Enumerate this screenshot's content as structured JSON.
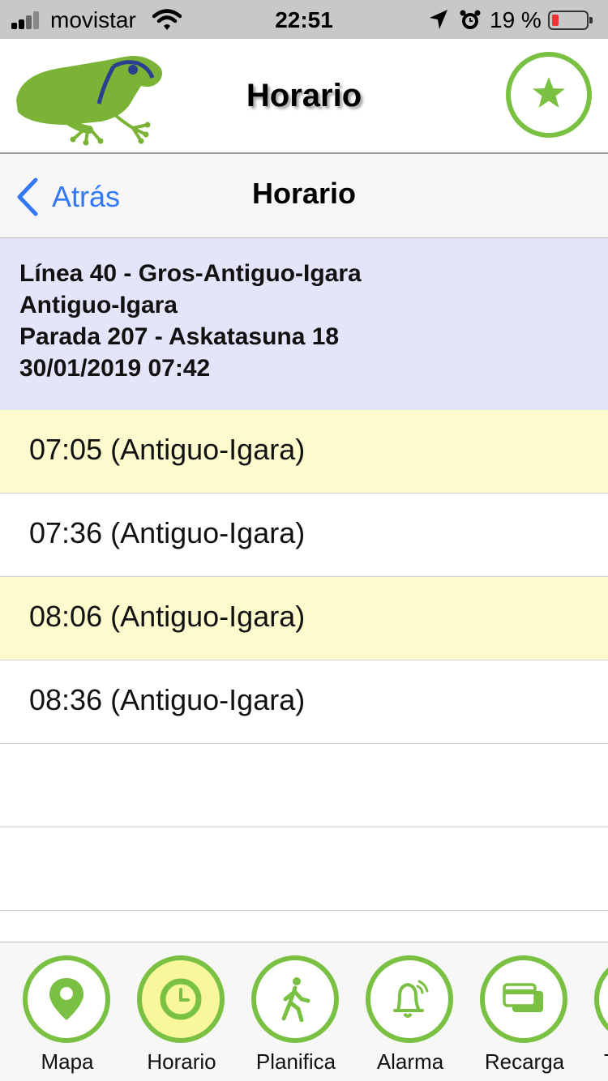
{
  "status_bar": {
    "carrier": "movistar",
    "time": "22:51",
    "battery_percent": "19 %",
    "battery_level": 0.19,
    "icons": [
      "signal-icon",
      "wifi-icon",
      "location-arrow-icon",
      "alarm-clock-icon",
      "battery-icon"
    ]
  },
  "header": {
    "title": "Horario",
    "logo": "frog-logo",
    "favorite_icon": "star-icon",
    "accent_color": "#7ac143"
  },
  "nav": {
    "back_label": "Atrás",
    "title": "Horario",
    "link_color": "#3478f6"
  },
  "info": {
    "line": "Línea 40 - Gros-Antiguo-Igara",
    "direction": "Antiguo-Igara",
    "stop": "Parada 207 - Askatasuna 18",
    "datetime": "30/01/2019 07:42",
    "background": "#e4e4fa"
  },
  "schedule": {
    "rows": [
      {
        "text": "07:05 (Antiguo-Igara)",
        "highlighted": true
      },
      {
        "text": "07:36 (Antiguo-Igara)",
        "highlighted": false
      },
      {
        "text": "08:06 (Antiguo-Igara)",
        "highlighted": true
      },
      {
        "text": "08:36 (Antiguo-Igara)",
        "highlighted": false
      },
      {
        "text": "",
        "highlighted": false
      },
      {
        "text": "",
        "highlighted": false
      }
    ],
    "highlight_color": "#fdfbce"
  },
  "tabs": [
    {
      "label": "Mapa",
      "icon": "map-pin-icon",
      "active": false
    },
    {
      "label": "Horario",
      "icon": "clock-icon",
      "active": true
    },
    {
      "label": "Planifica",
      "icon": "walking-person-icon",
      "active": false
    },
    {
      "label": "Alarma",
      "icon": "bell-icon",
      "active": false
    },
    {
      "label": "Recarga",
      "icon": "credit-card-icon",
      "active": false
    },
    {
      "label": "T",
      "icon": "",
      "active": false
    }
  ]
}
